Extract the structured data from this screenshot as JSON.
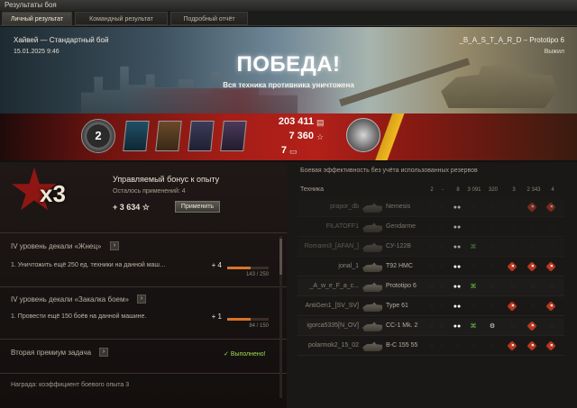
{
  "window": {
    "title": "Результаты боя"
  },
  "tabs": [
    {
      "label": "Личный результат",
      "active": true
    },
    {
      "label": "Командный результат",
      "active": false
    },
    {
      "label": "Подробный отчёт",
      "active": false
    }
  ],
  "battle": {
    "map_mode": "Хайвей — Стандартный бой",
    "datetime": "15.01.2025 9:46",
    "player_tank": "_B_A_S_T_A_R_D – Prototipo 6",
    "status": "Выжил",
    "result": "ПОБЕДА!",
    "result_sub": "Вся техника противника уничтожена"
  },
  "summary": {
    "rank": "2",
    "credits": "203 411",
    "xp": "7 360",
    "crew_xp": "7",
    "medal_icons": [
      "hero-medal-icon",
      "sniper-medal-icon",
      "chevron-medal-icon",
      "crossed-guns-medal-icon"
    ],
    "accent": "#b22019",
    "gold": "#f0b820"
  },
  "bonus": {
    "multiplier": "x3",
    "title": "Управляемый бонус к опыту",
    "remaining": "Осталось применений: 4",
    "value": "+ 3 634",
    "apply_label": "Применить"
  },
  "tasks": [
    {
      "title": "IV уровень декали «Жнец»",
      "line": "1. Уничтожить ещё 250 ед. техники на данной маш…",
      "bonus": "+ 4",
      "progress_label": "143 / 250",
      "progress": 0.572
    },
    {
      "title": "IV уровень декали «Закалка боем»",
      "line": "1. Провести ещё 150 боёв на данной машине.",
      "bonus": "+ 1",
      "progress_label": "84 / 150",
      "progress": 0.56
    }
  ],
  "premium_task": {
    "title": "Вторая премиум задача",
    "status": "Выполнено!"
  },
  "reward": "Награда:   коэффициент боевого опыта 3",
  "efficiency": {
    "title": "Боевая эффективность без учёта использованных резервов",
    "tech_header": "Техника",
    "columns": [
      "2",
      "-",
      "8",
      "3 091",
      "320",
      "3",
      "2 343",
      "4"
    ],
    "rows": [
      {
        "player": "prapor_db",
        "tank": "Nemesis",
        "cells": [
          "dim",
          "dim",
          "spot",
          "dim",
          "dim",
          "dim",
          "red",
          "red"
        ],
        "faded": true
      },
      {
        "player": "FILATOFF1",
        "tank": "Gendarme",
        "cells": [
          "dim",
          "dim",
          "spot",
          "dim",
          "dim",
          "dim",
          "dim",
          "dim"
        ],
        "faded": true
      },
      {
        "player": "Romann3_[AFAN_]",
        "tank": "СУ-122В",
        "cells": [
          "dim",
          "dim",
          "spot",
          "green",
          "dim",
          "dim",
          "dim",
          "dim"
        ],
        "faded": true
      },
      {
        "player": "jonal_1",
        "tank": "T92 HMC",
        "cells": [
          "dim",
          "dim",
          "spot",
          "dim",
          "dim",
          "red",
          "red",
          "red"
        ],
        "faded": false
      },
      {
        "player": "_A_w_e_F_a_c...",
        "tank": "Prototipo 6",
        "cells": [
          "dim",
          "dim",
          "spot",
          "green",
          "dim",
          "dim",
          "dim",
          "dim"
        ],
        "faded": false
      },
      {
        "player": "AntiGen1_[SV_SV]",
        "tank": "Type 61",
        "cells": [
          "dim",
          "dim",
          "spot",
          "dim",
          "dim",
          "red",
          "dim",
          "red"
        ],
        "faded": false
      },
      {
        "player": "igorca5335[N_OV]",
        "tank": "CC-1 Mk. 2",
        "cells": [
          "dim",
          "dim",
          "spot",
          "green",
          "track",
          "dim",
          "red",
          "dim"
        ],
        "faded": false
      },
      {
        "player": "polarmok2_15_02",
        "tank": "B-C 155 55",
        "cells": [
          "dim",
          "dim",
          "dim",
          "dim",
          "dim",
          "red",
          "red",
          "red"
        ],
        "faded": false
      }
    ]
  }
}
